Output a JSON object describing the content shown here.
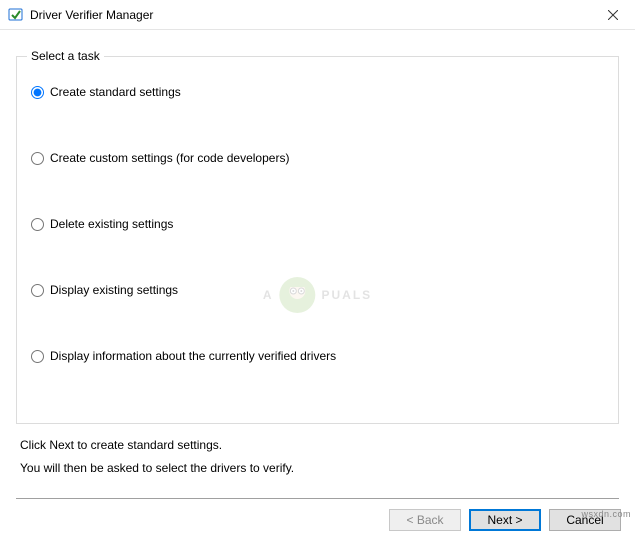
{
  "window": {
    "title": "Driver Verifier Manager"
  },
  "group": {
    "legend": "Select a task",
    "options": [
      {
        "label": "Create standard settings",
        "selected": true
      },
      {
        "label": "Create custom settings (for code developers)",
        "selected": false
      },
      {
        "label": "Delete existing settings",
        "selected": false
      },
      {
        "label": "Display existing settings",
        "selected": false
      },
      {
        "label": "Display information about the currently verified drivers",
        "selected": false
      }
    ]
  },
  "instructions": {
    "line1": "Click Next to create standard settings.",
    "line2": "You will then be asked to select the drivers to verify."
  },
  "buttons": {
    "back": "< Back",
    "next": "Next >",
    "cancel": "Cancel"
  },
  "watermark": {
    "pre": "A",
    "post": "PUALS"
  },
  "credit": "wsxdn.com"
}
